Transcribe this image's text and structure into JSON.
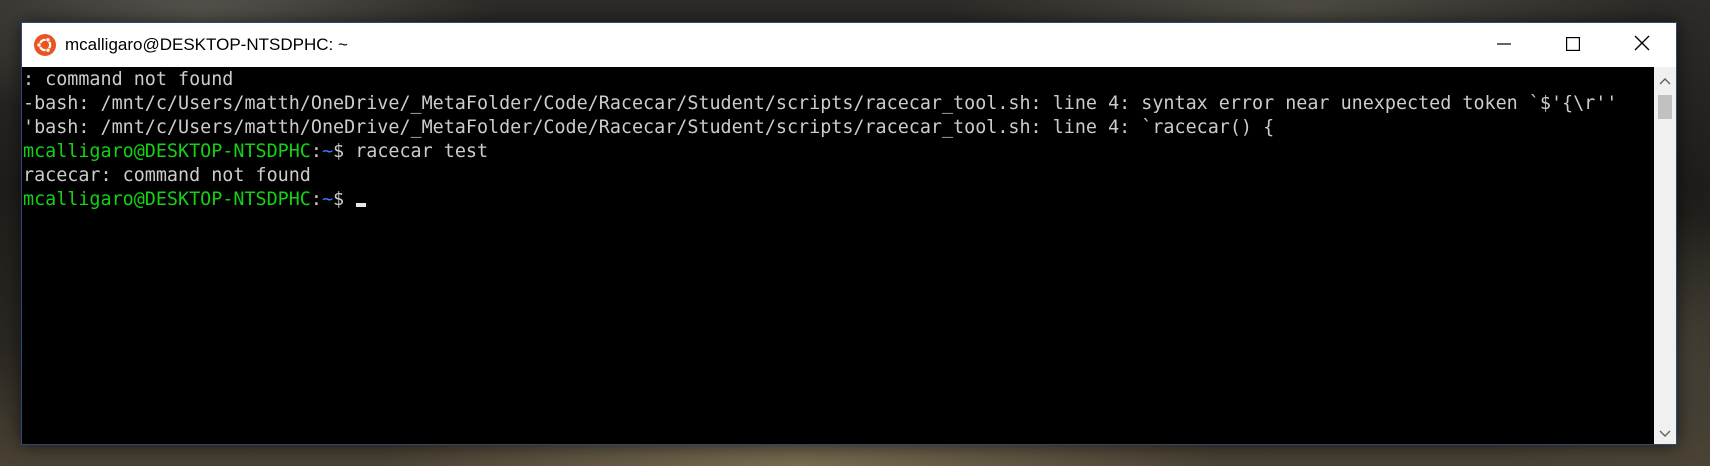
{
  "window": {
    "title": "mcalligaro@DESKTOP-NTSDPHC: ~",
    "app_icon": "ubuntu-icon",
    "controls": {
      "minimize_icon": "minimize-icon",
      "maximize_icon": "maximize-icon",
      "close_icon": "close-icon"
    }
  },
  "colors": {
    "prompt_user": "#13d113",
    "prompt_path": "#3b78ff",
    "text": "#cccccc",
    "background": "#000000",
    "ubuntu_orange": "#e95420"
  },
  "terminal": {
    "lines": [
      {
        "text": ": command not found"
      },
      {
        "text": "-bash: /mnt/c/Users/matth/OneDrive/_MetaFolder/Code/Racecar/Student/scripts/racecar_tool.sh: line 4: syntax error near unexpected token `$'{\\r''"
      },
      {
        "text": "'bash: /mnt/c/Users/matth/OneDrive/_MetaFolder/Code/Racecar/Student/scripts/racecar_tool.sh: line 4: `racecar() {"
      }
    ],
    "prompt1": {
      "user": "mcalligaro@DESKTOP-NTSDPHC",
      "sep": ":",
      "path": "~",
      "symbol": "$ ",
      "command": "racecar test"
    },
    "output1": "racecar: command not found",
    "prompt2": {
      "user": "mcalligaro@DESKTOP-NTSDPHC",
      "sep": ":",
      "path": "~",
      "symbol": "$ ",
      "command": ""
    }
  },
  "scrollbar": {
    "up_icon": "scroll-up-arrow-icon",
    "down_icon": "scroll-down-arrow-icon"
  }
}
